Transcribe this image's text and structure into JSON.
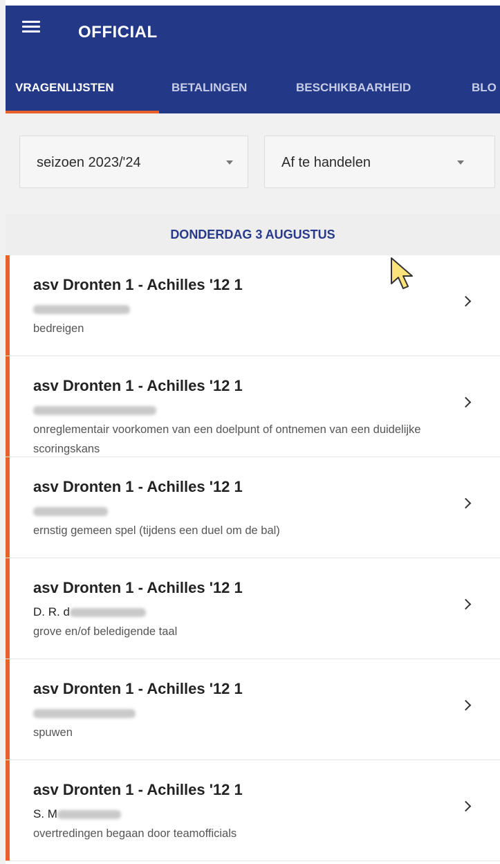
{
  "app": {
    "title": "OFFICIAL"
  },
  "tabs": [
    {
      "label": "VRAGENLIJSTEN",
      "active": true
    },
    {
      "label": "BETALINGEN",
      "active": false
    },
    {
      "label": "BESCHIKBAARHEID",
      "active": false
    },
    {
      "label": "BLO",
      "active": false
    }
  ],
  "filters": {
    "season": "seizoen 2023/'24",
    "status": "Af te handelen"
  },
  "date_header": "DONDERDAG 3 AUGUSTUS",
  "items": [
    {
      "match": "asv Dronten 1 - Achilles '12 1",
      "name_visible": "",
      "reason": "bedreigen"
    },
    {
      "match": "asv Dronten 1 - Achilles '12 1",
      "name_visible": "",
      "reason": "onreglementair voorkomen van een doelpunt of ontnemen van een duidelijke scoringskans"
    },
    {
      "match": "asv Dronten 1 - Achilles '12 1",
      "name_visible": "",
      "reason": "ernstig gemeen spel (tijdens een duel om de bal)"
    },
    {
      "match": "asv Dronten 1 - Achilles '12 1",
      "name_visible": "D. R. d",
      "reason": "grove en/of beledigende taal"
    },
    {
      "match": "asv Dronten 1 - Achilles '12 1",
      "name_visible": "",
      "reason": "spuwen"
    },
    {
      "match": "asv Dronten 1 - Achilles '12 1",
      "name_visible": "S. M",
      "reason": "overtredingen begaan door teamofficials"
    }
  ],
  "colors": {
    "appbar": "#233886",
    "accent": "#e8612c",
    "date_header_text": "#28398a"
  },
  "icons": {
    "menu": "hamburger-icon",
    "dropdown": "caret-down-icon",
    "row_action": "chevron-right-icon",
    "pointer": "mouse-cursor-icon"
  }
}
